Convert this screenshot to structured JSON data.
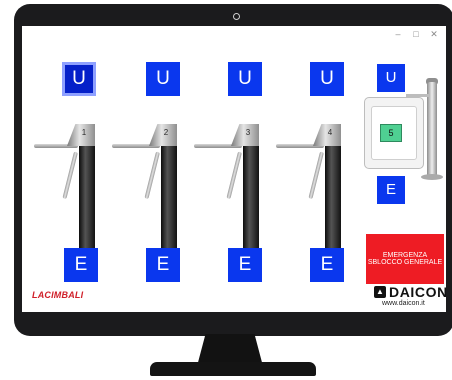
{
  "window": {
    "controls": [
      "–",
      "□",
      "✕"
    ]
  },
  "gates": [
    {
      "number": "1",
      "u_label": "U",
      "e_label": "E",
      "u_active": true
    },
    {
      "number": "2",
      "u_label": "U",
      "e_label": "E",
      "u_active": false
    },
    {
      "number": "3",
      "u_label": "U",
      "e_label": "E",
      "u_active": false
    },
    {
      "number": "4",
      "u_label": "U",
      "e_label": "E",
      "u_active": false
    }
  ],
  "gate5": {
    "number": "5",
    "u_label": "U",
    "e_label": "E"
  },
  "emergency": {
    "line1": "EMERGENZA",
    "line2": "SBLOCCO GENERALE"
  },
  "logos": {
    "lacimbali": "LACIMBALI",
    "daicon": "DAICON",
    "daicon_url": "www.daicon.it"
  },
  "colors": {
    "button_blue": "#0a37ee",
    "emergency_red": "#ee1c24",
    "gate5_green": "#4fd092"
  }
}
